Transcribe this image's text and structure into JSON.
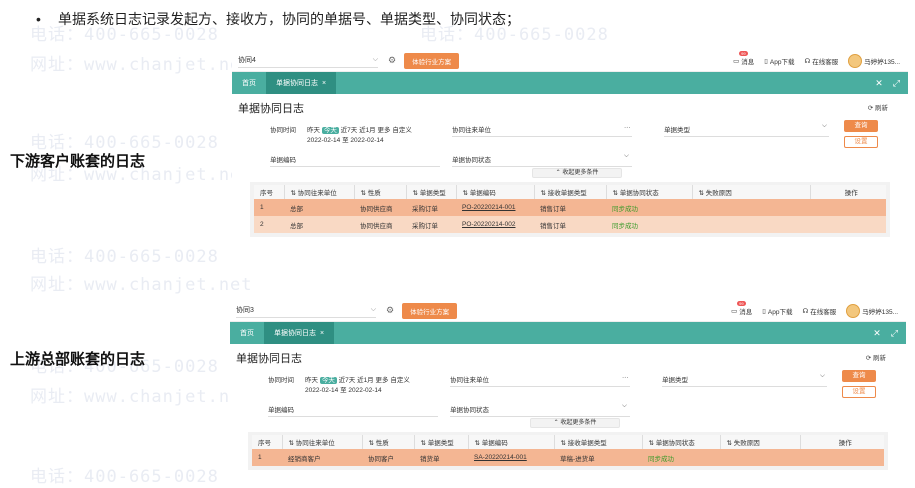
{
  "bullet": "单据系统日志记录发起方、接收方，协同的单据号、单据类型、协同状态；",
  "label_top": "下游客户账套的日志",
  "label_bottom": "上游总部账套的日志",
  "watermark": {
    "phone": "电话：400-665-0028",
    "site": "网址：www.chanjet.net"
  },
  "common": {
    "gear_icon": "gear-icon",
    "cta": "体验行业方案",
    "msg": "消息",
    "app": "App下载",
    "service": "在线客服",
    "user": "马婷婷135...",
    "home": "首页",
    "tab": "单据协同日志",
    "tab_close": "×",
    "page_title": "单据协同日志",
    "refresh": "刷新",
    "time_label": "协同时间",
    "time_opts": [
      "昨天",
      "今天",
      "近7天",
      "近1月",
      "更多",
      "自定义"
    ],
    "date_from": "2022-02-14",
    "date_to_sep": "至",
    "date_to": "2022-02-14",
    "partner_label": "协同往来单位",
    "doctype_label": "单据类型",
    "docno_label": "单据编码",
    "status_label": "单据协同状态",
    "query": "查询",
    "settings": "设置",
    "collapse": "收起更多条件",
    "ellipsis": "···",
    "columns": [
      "序号",
      "协同往来单位",
      "性质",
      "单据类型",
      "单据编码",
      "接收单据类型",
      "单据协同状态",
      "失败原因",
      "操作"
    ]
  },
  "top": {
    "account": "协同4",
    "badge": "99",
    "rows": [
      {
        "no": "1",
        "partner": "总部",
        "nature": "协同供应商",
        "doctype": "采购订单",
        "docno": "PO-20220214-001",
        "recv": "销售订单",
        "status": "同步成功",
        "reason": ""
      },
      {
        "no": "2",
        "partner": "总部",
        "nature": "协同供应商",
        "doctype": "采购订单",
        "docno": "PO-20220214-002",
        "recv": "销售订单",
        "status": "同步成功",
        "reason": ""
      }
    ]
  },
  "bottom": {
    "account": "协同3",
    "badge": "99",
    "rows": [
      {
        "no": "1",
        "partner": "经销商客户",
        "nature": "协同客户",
        "doctype": "销货单",
        "docno": "SA-20220214-001",
        "recv": "草稿-进货单",
        "status": "同步成功",
        "reason": ""
      }
    ]
  }
}
